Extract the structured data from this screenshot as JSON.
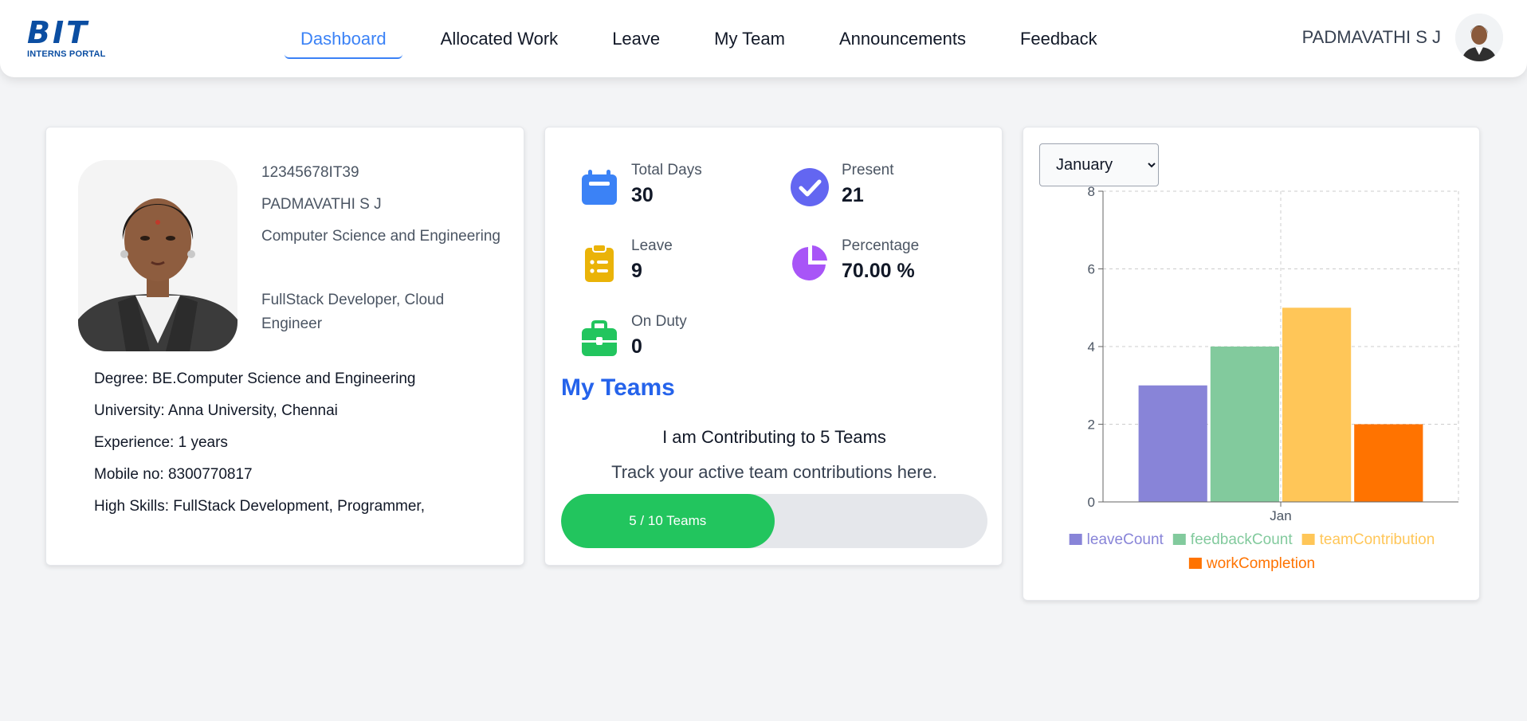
{
  "header": {
    "logo_title": "BIT",
    "logo_subtitle": "INTERNS PORTAL",
    "nav": [
      "Dashboard",
      "Allocated Work",
      "Leave",
      "My Team",
      "Announcements",
      "Feedback"
    ],
    "active_nav": "Dashboard",
    "user_name": "PADMAVATHI S J"
  },
  "profile": {
    "id": "12345678IT39",
    "name": "PADMAVATHI S J",
    "department": "Computer Science and Engineering",
    "role": "FullStack Developer, Cloud Engineer",
    "details": [
      "Degree: BE.Computer Science and Engineering",
      "University: Anna University, Chennai",
      "Experience: 1 years",
      "Mobile no: 8300770817",
      "High Skills: FullStack Development, Programmer,"
    ]
  },
  "stats": {
    "total_days": {
      "label": "Total Days",
      "value": "30"
    },
    "present": {
      "label": "Present",
      "value": "21"
    },
    "leave": {
      "label": "Leave",
      "value": "9"
    },
    "percentage": {
      "label": "Percentage",
      "value": "70.00 %"
    },
    "on_duty": {
      "label": "On Duty",
      "value": "0"
    },
    "colors": {
      "calendar": "#3b82f6",
      "present": "#6366f1",
      "leave": "#eab308",
      "percentage": "#a855f7",
      "on_duty": "#22c55e"
    }
  },
  "teams": {
    "title": "My Teams",
    "contributing_text": "I am Contributing to 5 Teams",
    "track_text": "Track your active team contributions here.",
    "progress_label": "5 / 10 Teams",
    "progress_fraction": 0.5
  },
  "chart": {
    "selected_month": "January",
    "months": [
      "January"
    ]
  },
  "chart_data": {
    "type": "bar",
    "categories": [
      "Jan"
    ],
    "series": [
      {
        "name": "leaveCount",
        "values": [
          3
        ],
        "color": "#8884d8"
      },
      {
        "name": "feedbackCount",
        "values": [
          4
        ],
        "color": "#82ca9d"
      },
      {
        "name": "teamContribution",
        "values": [
          5
        ],
        "color": "#ffc658"
      },
      {
        "name": "workCompletion",
        "values": [
          2
        ],
        "color": "#ff7300"
      }
    ],
    "ylim": [
      0,
      8
    ],
    "yticks": [
      0,
      2,
      4,
      6,
      8
    ],
    "grid": true,
    "legend": "bottom"
  }
}
